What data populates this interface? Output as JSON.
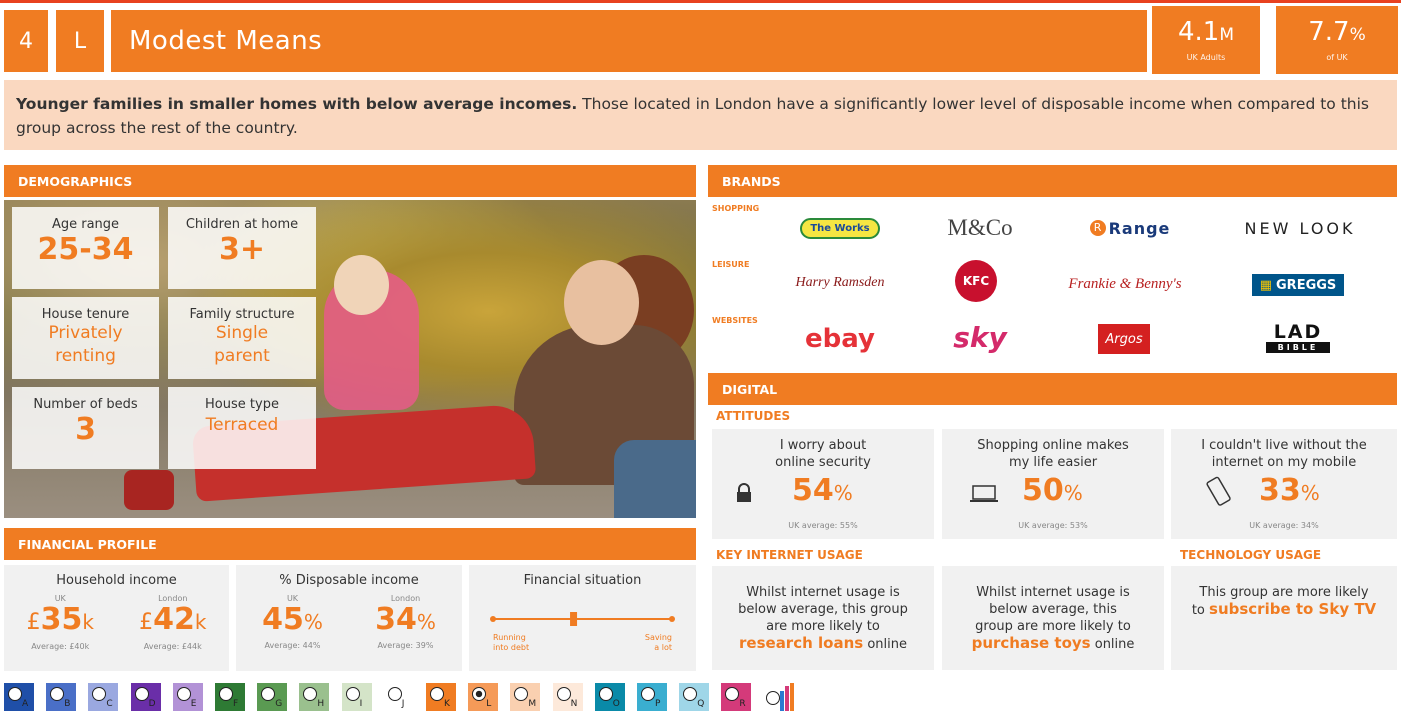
{
  "header": {
    "number": "4",
    "letter": "L",
    "title": "Modest Means",
    "stat1_value": "4.1",
    "stat1_unit": "M",
    "stat1_label": "UK Adults",
    "stat2_value": "7.7",
    "stat2_unit": "%",
    "stat2_label": "of UK"
  },
  "description": {
    "bold": "Younger families in smaller homes with below average incomes.",
    "rest": " Those located in London have a significantly lower level of disposable income when compared to this group across the rest of the country."
  },
  "demographics": {
    "header": "DEMOGRAPHICS",
    "age_label": "Age range",
    "age_value": "25-34",
    "children_label": "Children at home",
    "children_value": "3+",
    "tenure_label": "House tenure",
    "tenure_value_1": "Privately",
    "tenure_value_2": "renting",
    "family_label": "Family structure",
    "family_value_1": "Single",
    "family_value_2": "parent",
    "beds_label": "Number of beds",
    "beds_value": "3",
    "housetype_label": "House type",
    "housetype_value": "Terraced"
  },
  "financial": {
    "header": "FINANCIAL PROFILE",
    "income_label": "Household income",
    "income_uk_loc": "UK",
    "income_uk_cur": "£",
    "income_uk": "35",
    "income_uk_unit": "k",
    "income_uk_avg": "Average: £40k",
    "income_ldn_loc": "London",
    "income_ldn_cur": "£",
    "income_ldn": "42",
    "income_ldn_unit": "k",
    "income_ldn_avg": "Average: £44k",
    "disp_label": "% Disposable income",
    "disp_uk_loc": "UK",
    "disp_uk": "45",
    "disp_uk_unit": "%",
    "disp_uk_avg": "Average: 44%",
    "disp_ldn_loc": "London",
    "disp_ldn": "34",
    "disp_ldn_unit": "%",
    "disp_ldn_avg": "Average: 39%",
    "situation_label": "Financial situation",
    "situation_left_1": "Running",
    "situation_left_2": "into debt",
    "situation_right_1": "Saving",
    "situation_right_2": "a lot",
    "situation_level": 0.45
  },
  "brands": {
    "header": "BRANDS",
    "cat_shopping": "SHOPPING",
    "cat_leisure": "LEISURE",
    "cat_websites": "WEBSITES",
    "shopping": [
      "The Works",
      "M&Co",
      "Range",
      "NEW LOOK"
    ],
    "leisure": [
      "Harry Ramsden",
      "KFC",
      "Frankie & Benny's",
      "GREGGS"
    ],
    "websites": [
      "ebay",
      "sky",
      "Argos",
      "LAD",
      "BIBLE"
    ]
  },
  "digital": {
    "header": "DIGITAL",
    "attitudes_header": "ATTITUDES",
    "att1_text_1": "I worry about",
    "att1_text_2": "online security",
    "att1_pct": "54",
    "att1_unit": "%",
    "att1_avg": "UK average: 55%",
    "att2_text_1": "Shopping online makes",
    "att2_text_2": "my life easier",
    "att2_pct": "50",
    "att2_unit": "%",
    "att2_avg": "UK average: 53%",
    "att3_text_1": "I couldn't live without the",
    "att3_text_2": "internet on my mobile",
    "att3_pct": "33",
    "att3_unit": "%",
    "att3_avg": "UK average: 34%",
    "key_header": "KEY INTERNET USAGE",
    "tech_header": "TECHNOLOGY USAGE",
    "key1_1": "Whilst internet usage is",
    "key1_2": "below average, this group",
    "key1_3": "are more likely to",
    "key1_hl": "research loans",
    "key1_end": " online",
    "key2_1": "Whilst internet usage is",
    "key2_2": "below average, this",
    "key2_3": "group are more likely to",
    "key2_hl": "purchase toys",
    "key2_end": " online",
    "tech_1": "This group are more likely",
    "tech_2": "to ",
    "tech_hl": "subscribe to Sky TV"
  },
  "legend": {
    "letters": [
      "A",
      "B",
      "C",
      "D",
      "E",
      "F",
      "G",
      "H",
      "I",
      "J",
      "K",
      "L",
      "M",
      "N",
      "O",
      "P",
      "Q",
      "R"
    ],
    "colors": [
      "#1f4fa8",
      "#4a6fc7",
      "#9aa8e0",
      "#6a2ea8",
      "#b292d6",
      "#2e7a34",
      "#5a9a52",
      "#9ac08e",
      "#d4e4c8",
      "#ffffff",
      "#f07c22",
      "#f59a58",
      "#fad0b0",
      "#fde9da",
      "#0a8aa8",
      "#3aaed0",
      "#9fd6e8",
      "#d43a7a"
    ],
    "selected": "L"
  }
}
